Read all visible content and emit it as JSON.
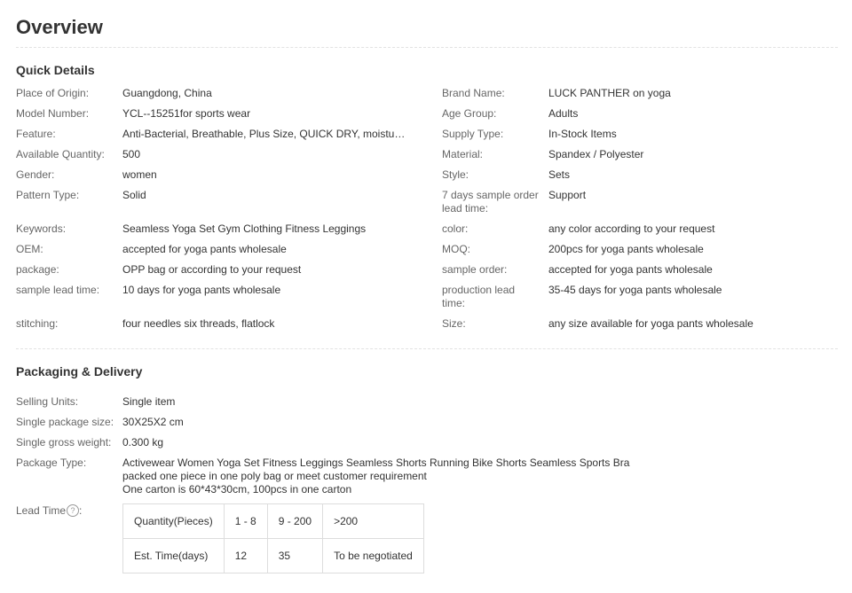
{
  "overview": {
    "title": "Overview"
  },
  "quick_details": {
    "title": "Quick Details",
    "left": [
      {
        "label": "Place of Origin:",
        "value": "Guangdong, China"
      },
      {
        "label": "Model Number:",
        "value": "YCL--15251for sports wear"
      },
      {
        "label": "Feature:",
        "value": "Anti-Bacterial, Breathable, Plus Size, QUICK DRY, moisture wi..."
      },
      {
        "label": "Available Quantity:",
        "value": "500"
      },
      {
        "label": "Gender:",
        "value": "women"
      },
      {
        "label": "Pattern Type:",
        "value": "Solid"
      },
      {
        "label": "Keywords:",
        "value": "Seamless Yoga Set Gym Clothing Fitness Leggings"
      },
      {
        "label": "OEM:",
        "value": "accepted for yoga pants wholesale"
      },
      {
        "label": "package:",
        "value": "OPP bag or according to your request"
      },
      {
        "label": "sample lead time:",
        "value": "10 days for yoga pants wholesale"
      },
      {
        "label": "stitching:",
        "value": "four needles six threads, flatlock"
      }
    ],
    "right": [
      {
        "label": "Brand Name:",
        "value": "LUCK PANTHER on yoga"
      },
      {
        "label": "Age Group:",
        "value": "Adults"
      },
      {
        "label": "Supply Type:",
        "value": "In-Stock Items"
      },
      {
        "label": "Material:",
        "value": "Spandex / Polyester"
      },
      {
        "label": "Style:",
        "value": "Sets"
      },
      {
        "label": "7 days sample order lead time:",
        "value": "Support"
      },
      {
        "label": "color:",
        "value": "any color according to your request"
      },
      {
        "label": "MOQ:",
        "value": "200pcs for yoga pants wholesale"
      },
      {
        "label": "sample order:",
        "value": "accepted for yoga pants wholesale"
      },
      {
        "label": "production lead time:",
        "value": "35-45 days for yoga pants wholesale"
      },
      {
        "label": "Size:",
        "value": "any size available for yoga pants wholesale"
      }
    ]
  },
  "packaging": {
    "title": "Packaging & Delivery",
    "selling_units": {
      "label": "Selling Units:",
      "value": "Single item"
    },
    "package_size": {
      "label": "Single package size:",
      "value": "30X25X2 cm"
    },
    "gross_weight": {
      "label": "Single gross weight:",
      "value": "0.300 kg"
    },
    "package_type": {
      "label": "Package Type:",
      "lines": [
        "Activewear Women Yoga Set Fitness Leggings Seamless Shorts Running Bike Shorts Seamless Sports Bra",
        "packed one piece in one poly bag or meet customer requirement",
        "One carton is 60*43*30cm, 100pcs in one carton"
      ]
    },
    "lead_time": {
      "label": "Lead Time",
      "help_icon": "question-circle-icon",
      "help_glyph": "?",
      "label_suffix": ":",
      "rows": [
        [
          "Quantity(Pieces)",
          "1 - 8",
          "9 - 200",
          ">200"
        ],
        [
          "Est. Time(days)",
          "12",
          "35",
          "To be negotiated"
        ]
      ]
    }
  }
}
